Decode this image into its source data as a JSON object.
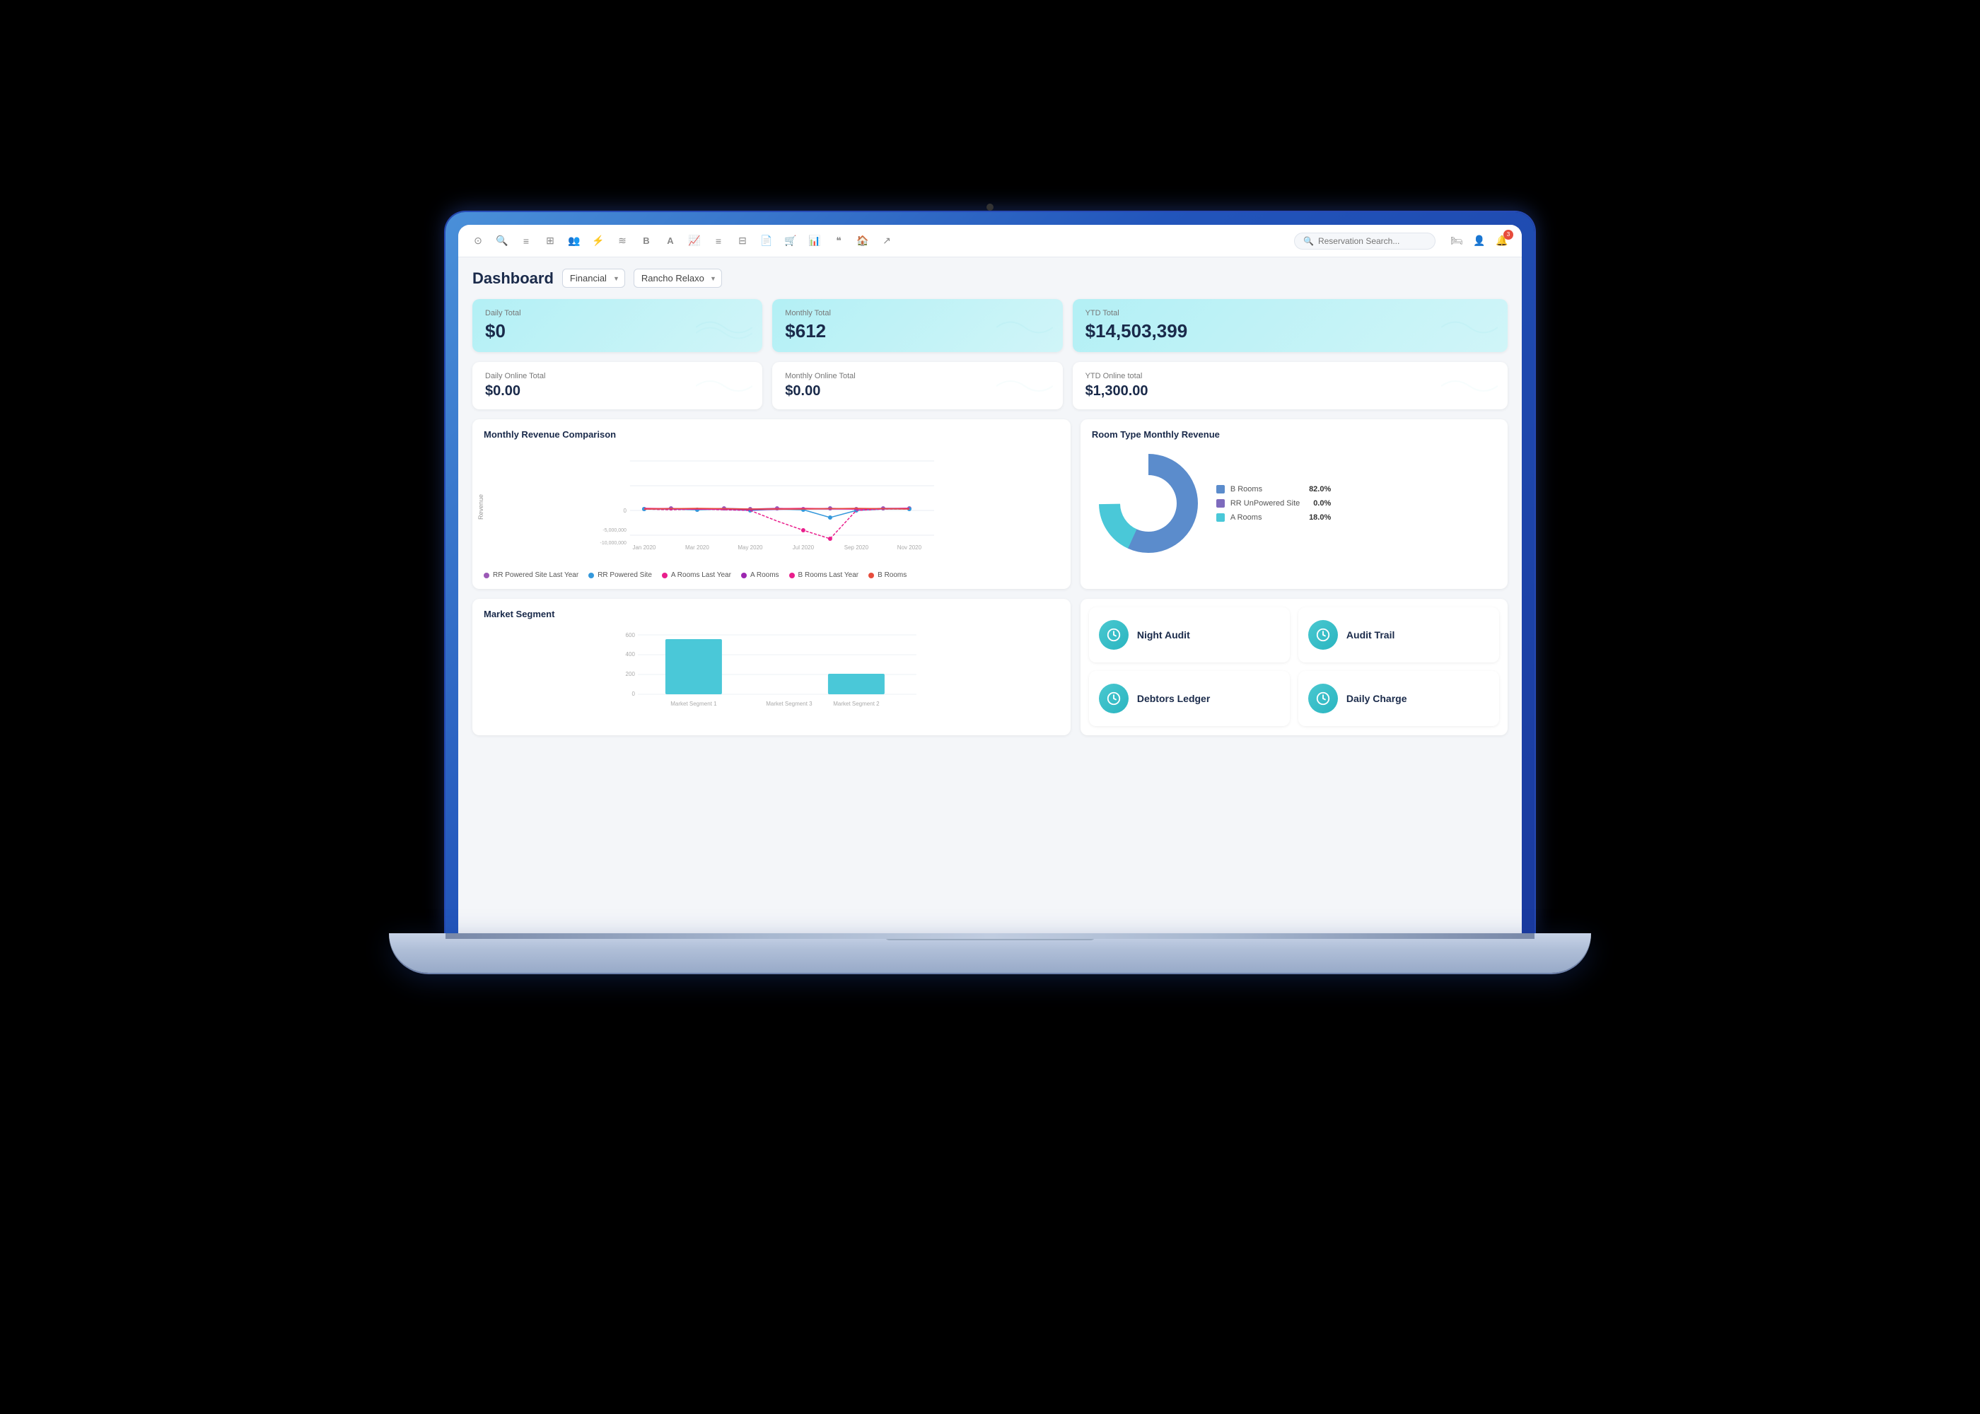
{
  "app": {
    "title": "Dashboard",
    "search_placeholder": "Reservation Search...",
    "notification_count": "3"
  },
  "dashboard": {
    "title": "Dashboard",
    "filter_label": "Financial",
    "property_label": "Rancho Relaxo"
  },
  "stats": {
    "daily_total_label": "Daily Total",
    "daily_total_value": "$0",
    "monthly_total_label": "Monthly Total",
    "monthly_total_value": "$612",
    "ytd_total_label": "YTD Total",
    "ytd_total_value": "$14,503,399",
    "daily_online_label": "Daily Online Total",
    "daily_online_value": "$0.00",
    "monthly_online_label": "Monthly Online Total",
    "monthly_online_value": "$0.00",
    "ytd_online_label": "YTD Online total",
    "ytd_online_value": "$1,300.00"
  },
  "revenue_chart": {
    "title": "Monthly Revenue Comparison",
    "y_label": "Revenue",
    "x_labels": [
      "Jan 2020",
      "Mar 2020",
      "May 2020",
      "Jul 2020",
      "Sep 2020",
      "Nov 2020"
    ],
    "y_ticks": [
      "0",
      "-5,000,000",
      "-10,000,000"
    ],
    "legend": [
      {
        "label": "RR Powered Site Last Year",
        "color": "#9b59b6"
      },
      {
        "label": "RR Powered Site",
        "color": "#3498db"
      },
      {
        "label": "A Rooms Last Year",
        "color": "#e91e8c"
      },
      {
        "label": "A Rooms",
        "color": "#9c27b0"
      },
      {
        "label": "B Rooms Last Year",
        "color": "#e91e8c"
      },
      {
        "label": "B Rooms",
        "color": "#e74c3c"
      }
    ]
  },
  "room_type_chart": {
    "title": "Room Type Monthly Revenue",
    "segments": [
      {
        "label": "B Rooms",
        "color": "#5b8ccc",
        "pct": "82.0%",
        "value": 82
      },
      {
        "label": "RR UnPowered Site",
        "color": "#7e6bbd",
        "pct": "0.0%",
        "value": 0
      },
      {
        "label": "A Rooms",
        "color": "#4ac8d8",
        "pct": "18.0%",
        "value": 18
      }
    ]
  },
  "market_segment": {
    "title": "Market Segment",
    "y_ticks": [
      "600",
      "400",
      "200",
      "0"
    ],
    "bars": [
      {
        "label": "Market Segment 1",
        "value": 500,
        "color": "#4ac8d8"
      },
      {
        "label": "Market Segment 3",
        "value": 0,
        "color": "#4ac8d8"
      },
      {
        "label": "Market Segment 2",
        "value": 180,
        "color": "#4ac8d8"
      }
    ]
  },
  "action_tiles": [
    {
      "label": "Night Audit",
      "icon": "🕐"
    },
    {
      "label": "Audit Trail",
      "icon": "📋"
    },
    {
      "label": "Debtors Ledger",
      "icon": "🕐"
    },
    {
      "label": "Daily Charge",
      "icon": "📋"
    }
  ],
  "nav_icons": [
    "⊙",
    "🔍",
    "≡",
    "⊞",
    "👥",
    "⚡",
    "≋",
    "B",
    "A",
    "📈",
    "≡",
    "⊟",
    "📄",
    "🛒",
    "📊",
    "❝",
    "🏠",
    "↗"
  ]
}
